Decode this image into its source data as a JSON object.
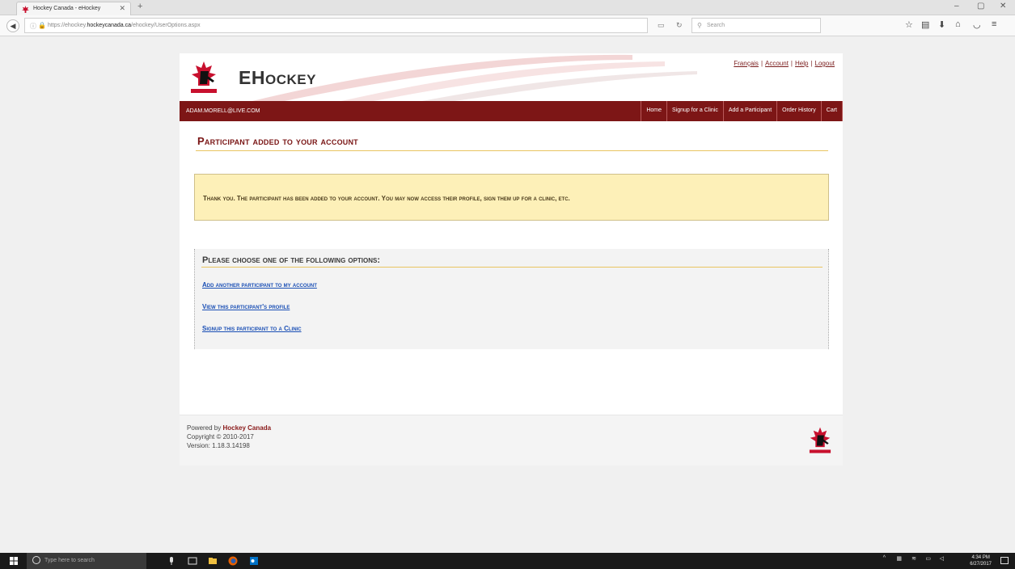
{
  "browser": {
    "tab_title": "Hockey Canada - eHockey",
    "tab_close": "✕",
    "new_tab": "+",
    "url_prefix": "https://ehockey.",
    "url_domain": "hockeycanada.ca",
    "url_path": "/ehockey/UserOptions.aspx",
    "search_placeholder": "Search",
    "window_controls": [
      "–",
      "▢",
      "✕"
    ]
  },
  "header": {
    "logo_text_big_e": "E",
    "logo_text_rest_h": "H",
    "logo_text_small": "OCKEY",
    "links": [
      "Français",
      "Account",
      "Help",
      "Logout"
    ]
  },
  "menubar": {
    "user_email": "ADAM.MORELL@LIVE.COM",
    "items": [
      "Home",
      "Signup for a Clinic",
      "Add a Participant",
      "Order History",
      "Cart"
    ]
  },
  "main": {
    "title": "Participant added to your account",
    "notice": "Thank you. The participant has been added to your account. You may now access their profile, sign them up for a clinic, etc.",
    "options_title": "Please choose one of the following options:",
    "options": [
      "Add another participant to my account",
      "View this participant's profile",
      "Signup this participant to a Clinic"
    ]
  },
  "footer": {
    "powered_by": "Powered by ",
    "brand": "Hockey Canada",
    "copyright": "Copyright © 2010-2017",
    "version": "Version: 1.18.3.14198"
  },
  "taskbar": {
    "search_placeholder": "Type here to search",
    "time": "4:34 PM",
    "date": "6/27/2017"
  },
  "colors": {
    "brand_red": "#7d1616",
    "link_blue": "#1a4fb5",
    "notice_bg": "#fdf0b8",
    "rule_gold": "#e8c460"
  }
}
